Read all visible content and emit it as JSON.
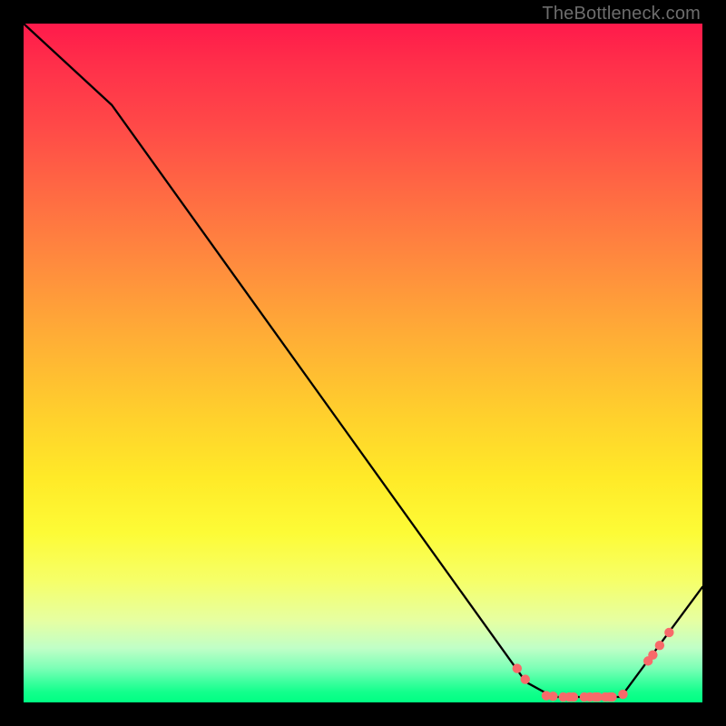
{
  "watermark": "TheBottleneck.com",
  "chart_data": {
    "type": "line",
    "title": "",
    "xlabel": "",
    "ylabel": "",
    "xlim": [
      0,
      100
    ],
    "ylim": [
      0,
      100
    ],
    "grid": false,
    "series": [
      {
        "name": "curve",
        "x": [
          0,
          13,
          74,
          78,
          88,
          100
        ],
        "y": [
          100,
          88,
          3,
          0.8,
          0.8,
          17
        ],
        "color": "#000000"
      }
    ],
    "markers": {
      "name": "dots",
      "color": "#f86a6a",
      "radius_px": 5.2,
      "points": [
        {
          "x": 72.7,
          "y": 5.0
        },
        {
          "x": 73.9,
          "y": 3.4
        },
        {
          "x": 77.0,
          "y": 1.0
        },
        {
          "x": 78.0,
          "y": 0.9
        },
        {
          "x": 79.5,
          "y": 0.8
        },
        {
          "x": 80.4,
          "y": 0.8
        },
        {
          "x": 81.0,
          "y": 0.8
        },
        {
          "x": 82.6,
          "y": 0.8
        },
        {
          "x": 83.4,
          "y": 0.8
        },
        {
          "x": 84.2,
          "y": 0.8
        },
        {
          "x": 84.6,
          "y": 0.8
        },
        {
          "x": 85.7,
          "y": 0.8
        },
        {
          "x": 86.3,
          "y": 0.8
        },
        {
          "x": 86.7,
          "y": 0.8
        },
        {
          "x": 88.3,
          "y": 1.2
        },
        {
          "x": 92.0,
          "y": 6.1
        },
        {
          "x": 92.7,
          "y": 7.0
        },
        {
          "x": 93.7,
          "y": 8.4
        },
        {
          "x": 95.1,
          "y": 10.3
        }
      ]
    },
    "background_gradient": {
      "stops": [
        {
          "pos": 0.0,
          "color": "#ff1a4b"
        },
        {
          "pos": 0.25,
          "color": "#ff6a43"
        },
        {
          "pos": 0.57,
          "color": "#ffce2d"
        },
        {
          "pos": 0.82,
          "color": "#f6ff68"
        },
        {
          "pos": 1.0,
          "color": "#00ff83"
        }
      ]
    }
  }
}
